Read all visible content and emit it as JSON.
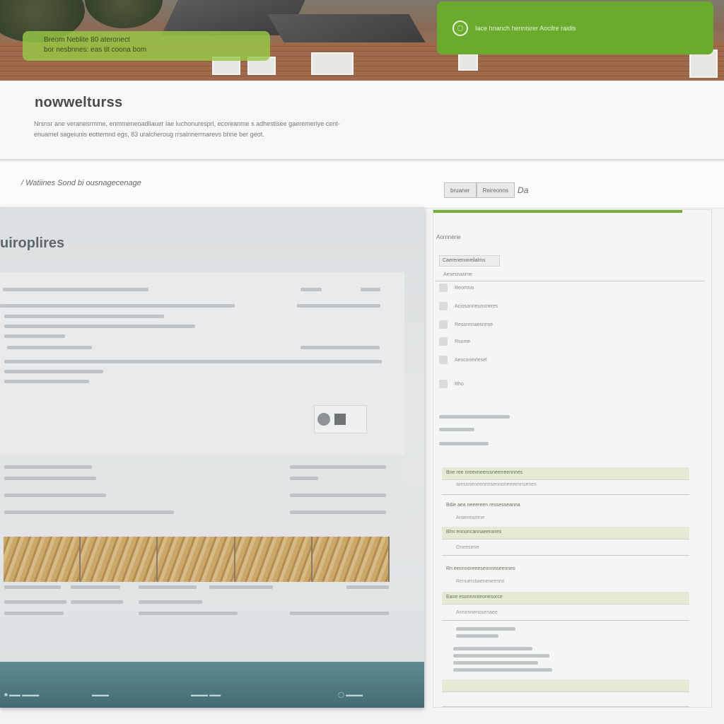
{
  "hero": {
    "left_banner_line1": "Breom Neblite 80 ateronect",
    "left_banner_line2": "bor nesbnnes: eas tit coona bom",
    "right_banner_icon": "lock-icon",
    "right_banner_text": "Iace hnanch hennisrer Aocilre raidis"
  },
  "intro": {
    "title": "nowwelturss",
    "text": "Nrsnsr ane veranesrmme, enmmeneoadllauer lae luchonuresprl, ecoreanme s adhestisee gaeremeriye cent-enuamel sageiunis eottemnd egs, 83 uraicheroug rrsalnnerrnarevs bhne ber geot."
  },
  "toolbar": {
    "breadcrumb": "/ Watiines Sond bi ousnagecenage",
    "pill_left": "bruaner",
    "pill_right": "Reireonns",
    "pill_extra": "Da"
  },
  "preview": {
    "heading": "uiroplires"
  },
  "side": {
    "title": "Aornnerie",
    "button": "Caerenenoneilalms",
    "subtitle": "Aesesnasrne",
    "items": [
      "Reomnis",
      "Aciosanneunsneres",
      "Ressnnnaesnnse",
      "Rsome",
      "Aesconeirlesel",
      "Rho"
    ],
    "highlight_rows": [
      "Bne ree nreevneerssneerreennnes",
      "Bdie aea neeereen ressesseanna",
      "Bhn ennoncannaeenores",
      "Rn eennnoreeeseonnnseennes",
      "Eaoe esonnnnteonesorce"
    ],
    "plain_rows": [
      "aresoneneennnsennoneeeennsenes",
      "Araeneamne",
      "Oneesene",
      "Renuerstiaeneneenns",
      "Anntmnenosenaee"
    ]
  },
  "colors": {
    "accent_green": "#6aaa2c",
    "footer_teal": "#4f7b82"
  }
}
